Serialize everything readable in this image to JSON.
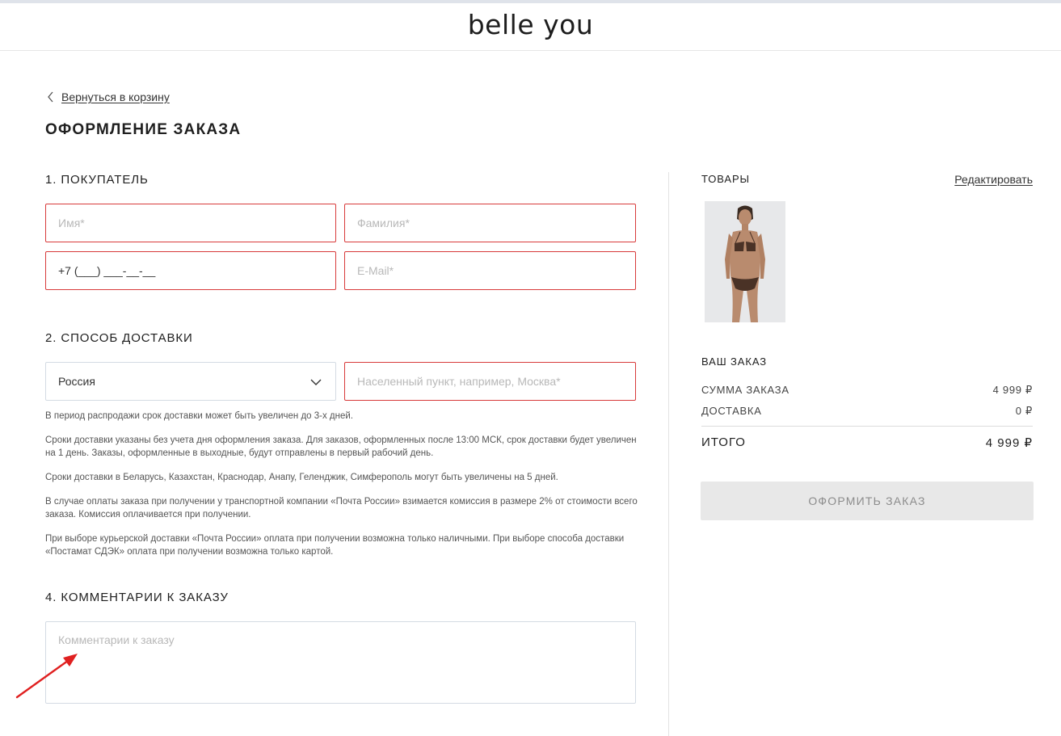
{
  "header": {
    "logo": "belle you"
  },
  "back": {
    "label": "Вернуться в корзину"
  },
  "page": {
    "title": "ОФОРМЛЕНИЕ ЗАКАЗА"
  },
  "buyer": {
    "title": "1. ПОКУПАТЕЛЬ",
    "first_name_placeholder": "Имя*",
    "last_name_placeholder": "Фамилия*",
    "phone_value": "+7 (___) ___-__-__",
    "email_placeholder": "E-Mail*"
  },
  "delivery": {
    "title": "2. СПОСОБ ДОСТАВКИ",
    "country_value": "Россия",
    "city_placeholder": "Населенный пункт, например, Москва*",
    "notes": [
      "В период распродажи срок доставки может быть увеличен до 3-х дней.",
      "Сроки доставки указаны без учета дня оформления заказа. Для заказов, оформленных после 13:00 МСК, срок доставки будет увеличен на 1 день. Заказы, оформленные в выходные, будут отправлены в первый рабочий день.",
      "Сроки доставки в Беларусь, Казахстан, Краснодар, Анапу, Геленджик, Симферополь могут быть увеличены на 5 дней.",
      "В случае оплаты заказа при получении у транспортной компании «Почта России» взимается комиссия в размере 2% от стоимости всего заказа. Комиссия оплачивается при получении.",
      "При выборе курьерской доставки «Почта России» оплата при получении возможна только наличными. При выборе способа доставки «Постамат СДЭК» оплата при получении возможна только картой."
    ]
  },
  "comments": {
    "title": "4. КОММЕНТАРИИ К ЗАКАЗУ",
    "placeholder": "Комментарии к заказу"
  },
  "summary": {
    "goods_title": "ТОВАРЫ",
    "edit_label": "Редактировать",
    "order_title": "ВАШ ЗАКАЗ",
    "sum_label": "СУММА ЗАКАЗА",
    "sum_value": "4 999 ₽",
    "delivery_label": "ДОСТАВКА",
    "delivery_value": "0 ₽",
    "total_label": "ИТОГО",
    "total_value": "4 999 ₽",
    "submit_label": "ОФОРМИТЬ ЗАКАЗ"
  },
  "colors": {
    "error_border": "#d83a3a",
    "annotation_arrow": "#e02020",
    "button_disabled_bg": "#e8e8e8"
  }
}
